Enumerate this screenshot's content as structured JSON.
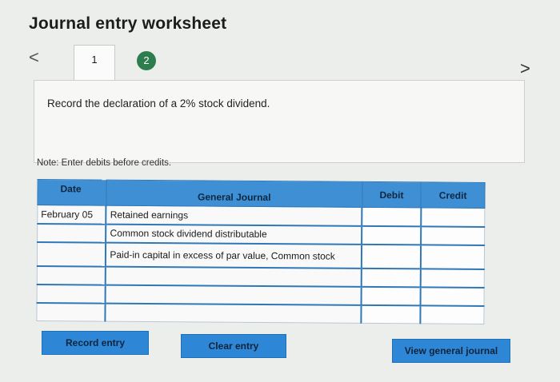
{
  "window": {
    "title": "Journal entry worksheet"
  },
  "navigation": {
    "prev_glyph": "<",
    "next_glyph": ">",
    "tabs": [
      {
        "label": "1",
        "active": true
      },
      {
        "label": "2",
        "active": false,
        "color": "#2e7d4f"
      }
    ]
  },
  "instruction": "Record the declaration of a 2% stock dividend.",
  "note": "Note: Enter debits before credits.",
  "journal": {
    "headers": {
      "date": "Date",
      "account": "General Journal",
      "debit": "Debit",
      "credit": "Credit"
    },
    "rows": [
      {
        "date": "February 05",
        "account": "Retained earnings",
        "debit": "",
        "credit": ""
      },
      {
        "date": "",
        "account": "Common stock dividend distributable",
        "debit": "",
        "credit": ""
      },
      {
        "date": "",
        "account": "Paid-in capital in excess of par value, Common stock",
        "debit": "",
        "credit": ""
      },
      {
        "date": "",
        "account": "",
        "debit": "",
        "credit": ""
      },
      {
        "date": "",
        "account": "",
        "debit": "",
        "credit": ""
      },
      {
        "date": "",
        "account": "",
        "debit": "",
        "credit": ""
      }
    ]
  },
  "buttons": {
    "record": "Record entry",
    "clear": "Clear entry",
    "view": "View general journal"
  },
  "colors": {
    "accent": "#3f8fd4",
    "button": "#2e86d6",
    "tab_badge": "#2e7d4f"
  }
}
